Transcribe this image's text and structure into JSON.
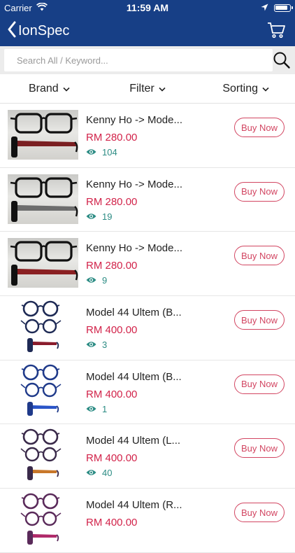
{
  "status_bar": {
    "carrier": "Carrier",
    "time": "11:59 AM"
  },
  "nav": {
    "back_label": "IonSpec"
  },
  "search": {
    "placeholder": "Search All / Keyword..."
  },
  "filters": {
    "brand": "Brand",
    "filter": "Filter",
    "sorting": "Sorting"
  },
  "products": [
    {
      "name": "Kenny Ho -> Mode...",
      "price": "RM 280.00",
      "views": "104",
      "button": "Buy Now",
      "image_style": "photo",
      "temple_color": "#7a1f22"
    },
    {
      "name": "Kenny Ho -> Mode...",
      "price": "RM 280.00",
      "views": "19",
      "button": "Buy Now",
      "image_style": "photo",
      "temple_color": "#6d6d6d"
    },
    {
      "name": "Kenny Ho -> Mode...",
      "price": "RM 280.00",
      "views": "9",
      "button": "Buy Now",
      "image_style": "photo",
      "temple_color": "#8a2022"
    },
    {
      "name": "Model 44 Ultem (B...",
      "price": "RM 400.00",
      "views": "3",
      "button": "Buy Now",
      "image_style": "stack",
      "rim_color": "#1e2a55",
      "accent_color": "#8a1c2c"
    },
    {
      "name": "Model 44 Ultem (B...",
      "price": "RM 400.00",
      "views": "1",
      "button": "Buy Now",
      "image_style": "stack",
      "rim_color": "#1f3a8a",
      "accent_color": "#2a55c8"
    },
    {
      "name": "Model 44 Ultem (L...",
      "price": "RM 400.00",
      "views": "40",
      "button": "Buy Now",
      "image_style": "stack",
      "rim_color": "#3a2a4a",
      "accent_color": "#c8772a"
    },
    {
      "name": "Model 44 Ultem (R...",
      "price": "RM 400.00",
      "views": "",
      "button": "Buy Now",
      "image_style": "stack",
      "rim_color": "#5a2a5a",
      "accent_color": "#b02a6a"
    }
  ],
  "colors": {
    "header": "#173f86",
    "price": "#d2234a",
    "buy_button": "#d24561",
    "views": "#2c8c84"
  },
  "icons": {
    "back": "chevron-left-icon",
    "cart": "cart-icon",
    "search": "search-icon",
    "dropdown": "chevron-down-icon",
    "views": "eye-icon"
  }
}
